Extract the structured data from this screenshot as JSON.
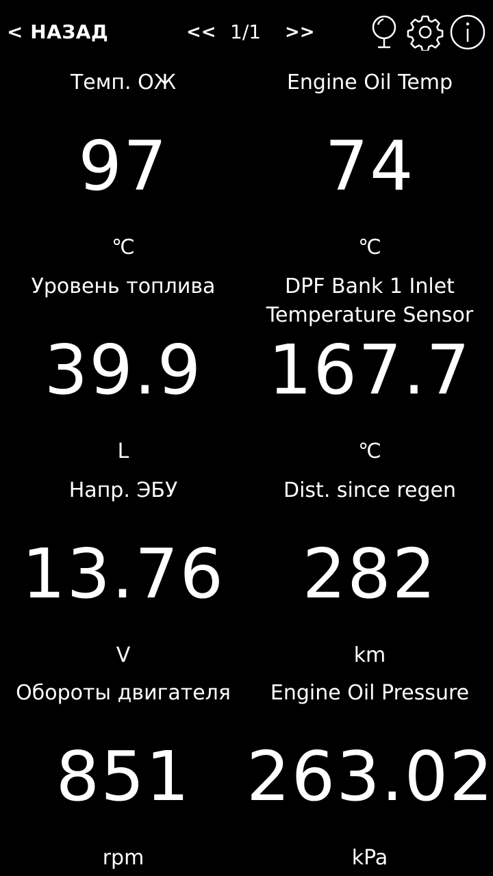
{
  "header": {
    "back_label": "< НАЗАД",
    "prev_label": "<<",
    "page_indicator": "1/1",
    "next_label": ">>",
    "icons": [
      "mirror-icon",
      "gear-icon",
      "info-icon"
    ]
  },
  "gauges": [
    {
      "label": "Темп. ОЖ",
      "value": "97",
      "unit": "℃"
    },
    {
      "label": "Engine Oil Temp",
      "value": "74",
      "unit": "℃"
    },
    {
      "label": "Уровень топлива",
      "value": "39.9",
      "unit": "L"
    },
    {
      "label_line1": "DPF Bank 1 Inlet",
      "label_line2": "Temperature Sensor",
      "value": "167.7",
      "unit": "℃"
    },
    {
      "label": "Напр. ЭБУ",
      "value": "13.76",
      "unit": "V"
    },
    {
      "label": "Dist. since regen",
      "value": "282",
      "unit": "km"
    },
    {
      "label": "Обороты двигателя",
      "value": "851",
      "unit": "rpm"
    },
    {
      "label": "Engine Oil Pressure",
      "value": "263.02",
      "unit": "kPa"
    }
  ]
}
